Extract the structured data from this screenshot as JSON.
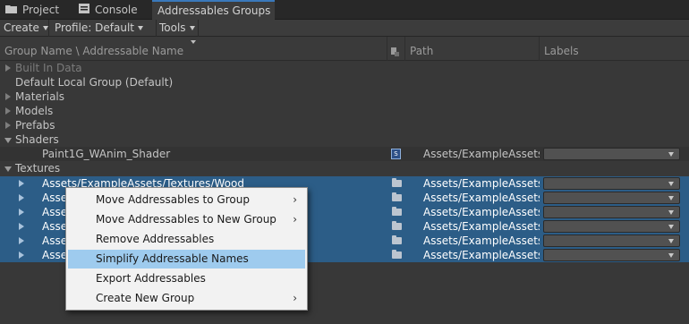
{
  "tabs": [
    {
      "label": "Project",
      "icon": "folder-icon"
    },
    {
      "label": "Console",
      "icon": "console-icon"
    },
    {
      "label": "Addressables Groups",
      "active": true
    }
  ],
  "toolbar": {
    "create": "Create",
    "profile": "Profile: Default",
    "tools": "Tools"
  },
  "header": {
    "name": "Group Name \\ Addressable Name",
    "path": "Path",
    "labels": "Labels"
  },
  "groups": {
    "built_in": "Built In Data",
    "default_local": "Default Local Group (Default)",
    "materials": "Materials",
    "models": "Models",
    "prefabs": "Prefabs",
    "shaders": "Shaders",
    "textures": "Textures"
  },
  "shader_entry": {
    "name": "Paint1G_WAnim_Shader",
    "path": "Assets/ExampleAssets/"
  },
  "texture_entries": [
    {
      "name": "Assets/ExampleAssets/Textures/Wood",
      "path": "Assets/ExampleAssets/"
    },
    {
      "name": "Asse",
      "path": "Assets/ExampleAssets/"
    },
    {
      "name": "Asse",
      "path": "Assets/ExampleAssets/"
    },
    {
      "name": "Asse",
      "path": "Assets/ExampleAssets/"
    },
    {
      "name": "Asse",
      "path": "Assets/ExampleAssets/"
    },
    {
      "name": "Asse",
      "path": "Assets/ExampleAssets/"
    }
  ],
  "context_menu": {
    "items": [
      {
        "label": "Move Addressables to Group",
        "submenu": true
      },
      {
        "label": "Move Addressables to New Group",
        "submenu": true
      },
      {
        "label": "Remove Addressables",
        "submenu": false
      },
      {
        "label": "Simplify Addressable Names",
        "submenu": false,
        "highlighted": true
      },
      {
        "label": "Export Addressables",
        "submenu": false
      },
      {
        "label": "Create New Group",
        "submenu": true
      }
    ],
    "submenu_glyph": "›"
  },
  "colors": {
    "selection": "#2c5d87",
    "menu_highlight": "#9ecbee",
    "tab_accent": "#3a79bb"
  }
}
